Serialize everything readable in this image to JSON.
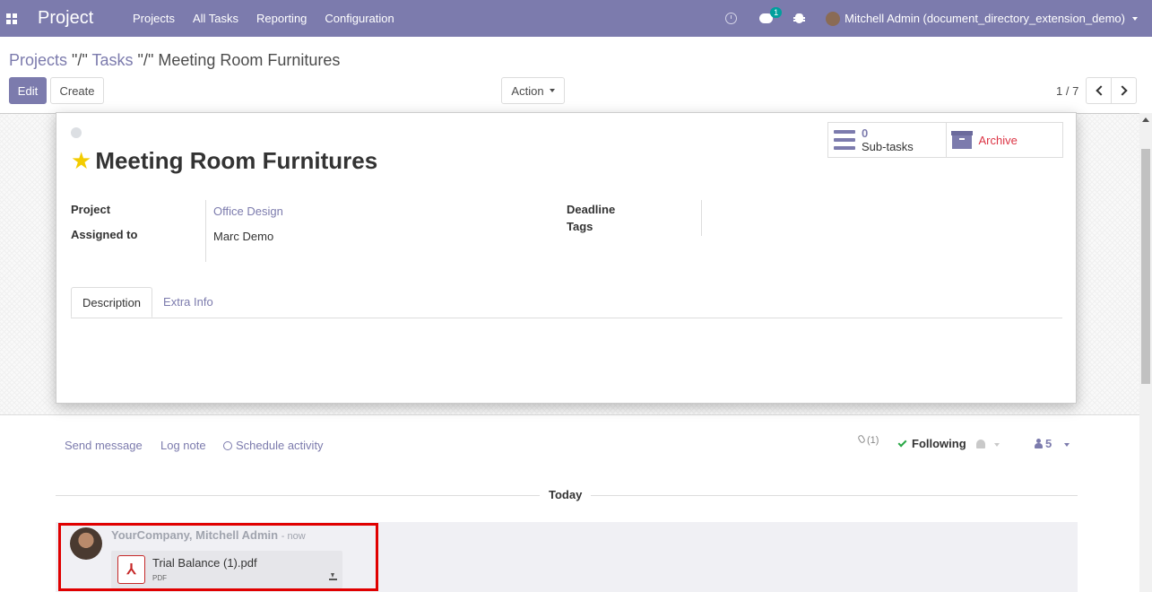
{
  "navbar": {
    "app_name": "Project",
    "menu": [
      "Projects",
      "All Tasks",
      "Reporting",
      "Configuration"
    ],
    "chat_badge": "1",
    "user": "Mitchell Admin (document_directory_extension_demo)"
  },
  "breadcrumb": {
    "projects": "Projects",
    "sep1": "\"/\"",
    "tasks": "Tasks",
    "sep2": "\"/\"",
    "current": "Meeting Room Furnitures"
  },
  "toolbar": {
    "edit": "Edit",
    "create": "Create",
    "action": "Action",
    "pager": "1 / 7"
  },
  "record": {
    "title": "Meeting Room Furnitures",
    "subtasks_count": "0",
    "subtasks_label": "Sub-tasks",
    "archive_label": "Archive",
    "fields": {
      "project_label": "Project",
      "project_value": "Office Design",
      "assigned_label": "Assigned to",
      "assigned_value": "Marc Demo",
      "deadline_label": "Deadline",
      "tags_label": "Tags"
    },
    "tabs": [
      "Description",
      "Extra Info"
    ]
  },
  "chatter": {
    "send_message": "Send message",
    "log_note": "Log note",
    "schedule_activity": "Schedule activity",
    "attachments_count": "(1)",
    "following": "Following",
    "followers_count": "5",
    "today": "Today",
    "message": {
      "author": "YourCompany, Mitchell Admin",
      "time": "- now",
      "attachment_name": "Trial Balance (1).pdf",
      "attachment_type": "PDF"
    }
  },
  "colors": {
    "brand": "#7c7bad",
    "danger": "#dc3545",
    "star": "#f3cc00",
    "highlight": "#e00000"
  }
}
